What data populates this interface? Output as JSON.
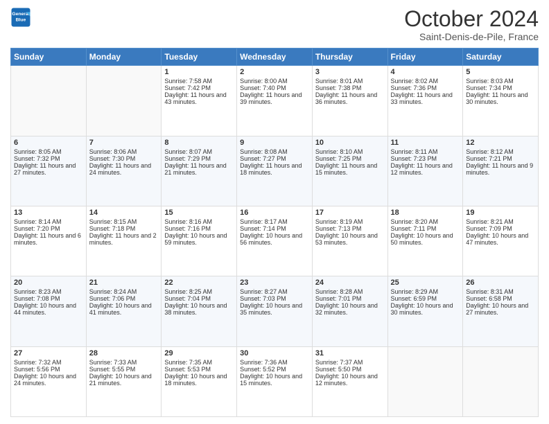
{
  "header": {
    "logo_general": "General",
    "logo_blue": "Blue",
    "month_title": "October 2024",
    "location": "Saint-Denis-de-Pile, France"
  },
  "days_of_week": [
    "Sunday",
    "Monday",
    "Tuesday",
    "Wednesday",
    "Thursday",
    "Friday",
    "Saturday"
  ],
  "weeks": [
    [
      {
        "day": "",
        "info": ""
      },
      {
        "day": "",
        "info": ""
      },
      {
        "day": "1",
        "info": "Sunrise: 7:58 AM\nSunset: 7:42 PM\nDaylight: 11 hours and 43 minutes."
      },
      {
        "day": "2",
        "info": "Sunrise: 8:00 AM\nSunset: 7:40 PM\nDaylight: 11 hours and 39 minutes."
      },
      {
        "day": "3",
        "info": "Sunrise: 8:01 AM\nSunset: 7:38 PM\nDaylight: 11 hours and 36 minutes."
      },
      {
        "day": "4",
        "info": "Sunrise: 8:02 AM\nSunset: 7:36 PM\nDaylight: 11 hours and 33 minutes."
      },
      {
        "day": "5",
        "info": "Sunrise: 8:03 AM\nSunset: 7:34 PM\nDaylight: 11 hours and 30 minutes."
      }
    ],
    [
      {
        "day": "6",
        "info": "Sunrise: 8:05 AM\nSunset: 7:32 PM\nDaylight: 11 hours and 27 minutes."
      },
      {
        "day": "7",
        "info": "Sunrise: 8:06 AM\nSunset: 7:30 PM\nDaylight: 11 hours and 24 minutes."
      },
      {
        "day": "8",
        "info": "Sunrise: 8:07 AM\nSunset: 7:29 PM\nDaylight: 11 hours and 21 minutes."
      },
      {
        "day": "9",
        "info": "Sunrise: 8:08 AM\nSunset: 7:27 PM\nDaylight: 11 hours and 18 minutes."
      },
      {
        "day": "10",
        "info": "Sunrise: 8:10 AM\nSunset: 7:25 PM\nDaylight: 11 hours and 15 minutes."
      },
      {
        "day": "11",
        "info": "Sunrise: 8:11 AM\nSunset: 7:23 PM\nDaylight: 11 hours and 12 minutes."
      },
      {
        "day": "12",
        "info": "Sunrise: 8:12 AM\nSunset: 7:21 PM\nDaylight: 11 hours and 9 minutes."
      }
    ],
    [
      {
        "day": "13",
        "info": "Sunrise: 8:14 AM\nSunset: 7:20 PM\nDaylight: 11 hours and 6 minutes."
      },
      {
        "day": "14",
        "info": "Sunrise: 8:15 AM\nSunset: 7:18 PM\nDaylight: 11 hours and 2 minutes."
      },
      {
        "day": "15",
        "info": "Sunrise: 8:16 AM\nSunset: 7:16 PM\nDaylight: 10 hours and 59 minutes."
      },
      {
        "day": "16",
        "info": "Sunrise: 8:17 AM\nSunset: 7:14 PM\nDaylight: 10 hours and 56 minutes."
      },
      {
        "day": "17",
        "info": "Sunrise: 8:19 AM\nSunset: 7:13 PM\nDaylight: 10 hours and 53 minutes."
      },
      {
        "day": "18",
        "info": "Sunrise: 8:20 AM\nSunset: 7:11 PM\nDaylight: 10 hours and 50 minutes."
      },
      {
        "day": "19",
        "info": "Sunrise: 8:21 AM\nSunset: 7:09 PM\nDaylight: 10 hours and 47 minutes."
      }
    ],
    [
      {
        "day": "20",
        "info": "Sunrise: 8:23 AM\nSunset: 7:08 PM\nDaylight: 10 hours and 44 minutes."
      },
      {
        "day": "21",
        "info": "Sunrise: 8:24 AM\nSunset: 7:06 PM\nDaylight: 10 hours and 41 minutes."
      },
      {
        "day": "22",
        "info": "Sunrise: 8:25 AM\nSunset: 7:04 PM\nDaylight: 10 hours and 38 minutes."
      },
      {
        "day": "23",
        "info": "Sunrise: 8:27 AM\nSunset: 7:03 PM\nDaylight: 10 hours and 35 minutes."
      },
      {
        "day": "24",
        "info": "Sunrise: 8:28 AM\nSunset: 7:01 PM\nDaylight: 10 hours and 32 minutes."
      },
      {
        "day": "25",
        "info": "Sunrise: 8:29 AM\nSunset: 6:59 PM\nDaylight: 10 hours and 30 minutes."
      },
      {
        "day": "26",
        "info": "Sunrise: 8:31 AM\nSunset: 6:58 PM\nDaylight: 10 hours and 27 minutes."
      }
    ],
    [
      {
        "day": "27",
        "info": "Sunrise: 7:32 AM\nSunset: 5:56 PM\nDaylight: 10 hours and 24 minutes."
      },
      {
        "day": "28",
        "info": "Sunrise: 7:33 AM\nSunset: 5:55 PM\nDaylight: 10 hours and 21 minutes."
      },
      {
        "day": "29",
        "info": "Sunrise: 7:35 AM\nSunset: 5:53 PM\nDaylight: 10 hours and 18 minutes."
      },
      {
        "day": "30",
        "info": "Sunrise: 7:36 AM\nSunset: 5:52 PM\nDaylight: 10 hours and 15 minutes."
      },
      {
        "day": "31",
        "info": "Sunrise: 7:37 AM\nSunset: 5:50 PM\nDaylight: 10 hours and 12 minutes."
      },
      {
        "day": "",
        "info": ""
      },
      {
        "day": "",
        "info": ""
      }
    ]
  ]
}
